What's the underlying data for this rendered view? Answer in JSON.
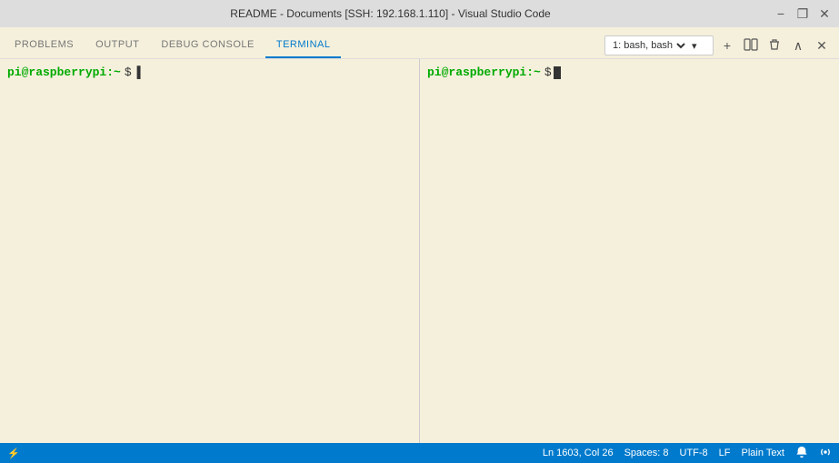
{
  "window": {
    "title": "README - Documents [SSH: 192.168.1.110] - Visual Studio Code",
    "minimize_label": "−",
    "restore_label": "❐",
    "close_label": "✕"
  },
  "panel_tabs": {
    "items": [
      {
        "id": "problems",
        "label": "PROBLEMS",
        "active": false
      },
      {
        "id": "output",
        "label": "OUTPUT",
        "active": false
      },
      {
        "id": "debug_console",
        "label": "DEBUG CONSOLE",
        "active": false
      },
      {
        "id": "terminal",
        "label": "TERMINAL",
        "active": true
      }
    ]
  },
  "terminal_controls": {
    "dropdown_value": "1: bash, bash",
    "dropdown_options": [
      "1: bash, bash"
    ],
    "add_label": "+",
    "split_label": "⧉",
    "trash_label": "🗑",
    "chevron_down_label": "∨",
    "close_label": "✕"
  },
  "terminal_left": {
    "prompt": "pi@raspberrypi:~",
    "dollar": "$",
    "input": "□"
  },
  "terminal_right": {
    "prompt": "pi@raspberrypi:~",
    "dollar": "$",
    "cursor": true
  },
  "status_bar": {
    "ln_col": "Ln 1603, Col 26",
    "spaces": "Spaces: 8",
    "encoding": "UTF-8",
    "line_ending": "LF",
    "language": "Plain Text",
    "notifications_icon": "🔔",
    "remote_icon": "⚡"
  }
}
